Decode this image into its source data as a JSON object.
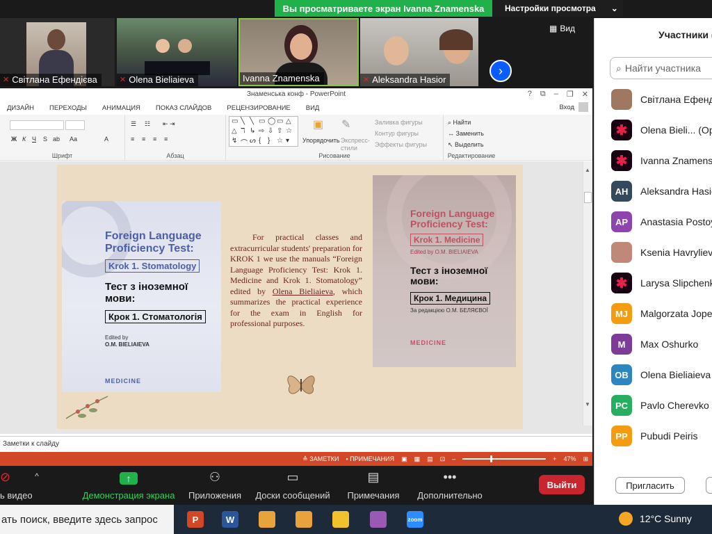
{
  "share": {
    "banner": "Вы просматриваете экран Ivanna Znamenska",
    "view_settings": "Настройки просмотра"
  },
  "video_strip": {
    "tiles": [
      {
        "name": "Світлана Ефендієва"
      },
      {
        "name": "Olena Bieliaieva"
      },
      {
        "name": "Ivanna Znamenska"
      },
      {
        "name": "Aleksandra Hasior"
      }
    ],
    "view_label": "Вид"
  },
  "ppt": {
    "window_title": "Знаменська конф - PowerPoint",
    "tabs": [
      "ДИЗАЙН",
      "ПЕРЕХОДЫ",
      "АНИМАЦИЯ",
      "ПОКАЗ СЛАЙДОВ",
      "РЕЦЕНЗИРОВАНИЕ",
      "ВИД"
    ],
    "login": "Вход",
    "ribbon": {
      "groups": [
        "Шрифт",
        "Абзац",
        "Рисование",
        "Редактирование"
      ],
      "arrange": "Упорядочить",
      "express_styles": "Экспресс-стили",
      "fill": "Заливка фигуры",
      "outline": "Контур фигуры",
      "effects": "Эффекты фигуры",
      "find": "Найти",
      "replace": "Заменить",
      "select": "Выделить"
    },
    "slide": {
      "book_left": {
        "title_en": "Foreign Language Proficiency Test:",
        "tag_en": "Krok 1. Stomatology",
        "title_uk": "Тест з іноземної мови:",
        "tag_uk": "Крок 1. Стоматологія",
        "editor_label": "Edited by",
        "editor": "O.M. BIELIAIEVA",
        "brand": "MEDICINE"
      },
      "book_right": {
        "title_en": "Foreign Language Proficiency Test:",
        "tag_en": "Krok 1. Medicine",
        "edited": "Edited by O.M. BIELIAIEVA",
        "title_uk": "Тест з іноземної мови:",
        "tag_uk": "Крок 1. Медицина",
        "edited_uk": "За редакцією О.М. БЕЛЯЄВОЇ",
        "brand": "MEDICINE"
      },
      "text_before": "For practical classes and extracurricular students' preparation for KROK 1 we use the manuals “Foreign Language Proficiency Test: Krok 1. Medicine and Krok 1. Stomatology” edited by ",
      "text_link": "Olena Bieliaieva",
      "text_after": ", which summarizes the practical experience for the exam in English for professional purposes."
    },
    "notes_label": "Заметки к слайду",
    "status": {
      "notes": "ЗАМЕТКИ",
      "comments": "ПРИМЕЧАНИЯ",
      "zoom": "47%"
    }
  },
  "toolbar": {
    "video": "ь видео",
    "share": "Демонстрация экрана",
    "apps": "Приложения",
    "boards": "Доски сообщений",
    "notes": "Примечания",
    "more": "Дополнительно",
    "leave": "Выйти"
  },
  "participants": {
    "title": "Участники (",
    "search_placeholder": "Найти участника",
    "items": [
      {
        "name": "Світлана Ефендієва",
        "initials": "",
        "color": "#a07860"
      },
      {
        "name": "Olena Bieli...  (Op",
        "initials": "",
        "color": "#1a0010"
      },
      {
        "name": "Ivanna Znamensk",
        "initials": "",
        "color": "#1a0010"
      },
      {
        "name": "Aleksandra Hasic",
        "initials": "AH",
        "color": "#34495e"
      },
      {
        "name": "Anastasia Postoy",
        "initials": "AP",
        "color": "#8e44ad"
      },
      {
        "name": "Ksenia Havrylieva",
        "initials": "",
        "color": "#c08878"
      },
      {
        "name": "Larysa Slipchenko",
        "initials": "",
        "color": "#1a0010"
      },
      {
        "name": "Malgorzata Jope",
        "initials": "MJ",
        "color": "#f39c12"
      },
      {
        "name": "Max Oshurko",
        "initials": "M",
        "color": "#7d3c98"
      },
      {
        "name": "Olena Bieliaieva",
        "initials": "OB",
        "color": "#2e86c1"
      },
      {
        "name": "Pavlo Cherevko",
        "initials": "PC",
        "color": "#27ae60"
      },
      {
        "name": "Pubudi Peiris",
        "initials": "PP",
        "color": "#f39c12"
      }
    ],
    "invite": "Пригласить"
  },
  "taskbar": {
    "search_text": "ать поиск, введите здесь запрос",
    "apps": [
      {
        "label": "P",
        "color": "#d24726"
      },
      {
        "label": "W",
        "color": "#2b579a"
      },
      {
        "label": "",
        "color": "#e8a33d"
      },
      {
        "label": "",
        "color": "#e8a33d"
      },
      {
        "label": "",
        "color": "#f2c12e"
      },
      {
        "label": "",
        "color": "#9b59b6"
      },
      {
        "label": "zoom",
        "color": "#2d8cff"
      }
    ],
    "weather": "12°C  Sunny"
  }
}
